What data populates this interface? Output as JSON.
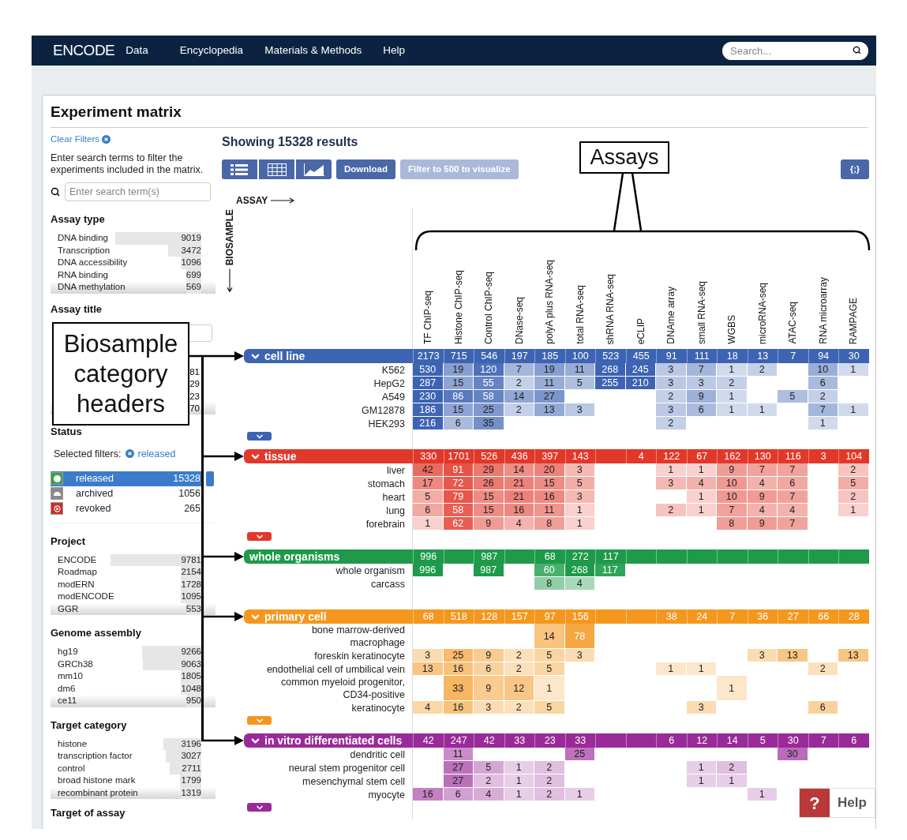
{
  "nav": {
    "logo": "ENCODE",
    "links": [
      "Data",
      "Encyclopedia",
      "Materials & Methods",
      "Help"
    ],
    "search": {
      "placeholder": "Search..."
    }
  },
  "title": "Experiment matrix",
  "sidebar": {
    "clear_filters": "Clear Filters",
    "intro": "Enter search terms to filter the experiments included in the matrix.",
    "search": {
      "placeholder": "Enter search term(s)"
    },
    "facets": [
      {
        "kind": "list",
        "title": "Assay type",
        "items": [
          {
            "label": "DNA binding",
            "count": "9019"
          },
          {
            "label": "Transcription",
            "count": "3472"
          },
          {
            "label": "DNA accessibility",
            "count": "1096"
          },
          {
            "label": "RNA binding",
            "count": "699"
          },
          {
            "label": "DNA methylation",
            "count": "569"
          }
        ]
      },
      {
        "kind": "covered",
        "title": "Assay title",
        "counts": [
          "81",
          "29",
          "23",
          "70"
        ]
      },
      {
        "kind": "status",
        "title": "Status",
        "selected_label": "Selected filters:",
        "selected_filters": [
          "released"
        ],
        "items": [
          {
            "kind": "released",
            "label": "released",
            "count": "15328",
            "selected": true
          },
          {
            "kind": "archived",
            "label": "archived",
            "count": "1056",
            "selected": false
          },
          {
            "kind": "revoked",
            "label": "revoked",
            "count": "265",
            "selected": false
          }
        ]
      },
      {
        "kind": "list",
        "title": "Project",
        "items": [
          {
            "label": "ENCODE",
            "count": "9781"
          },
          {
            "label": "Roadmap",
            "count": "2154"
          },
          {
            "label": "modERN",
            "count": "1728"
          },
          {
            "label": "modENCODE",
            "count": "1095"
          },
          {
            "label": "GGR",
            "count": "553"
          }
        ]
      },
      {
        "kind": "list",
        "title": "Genome assembly",
        "items": [
          {
            "label": "hg19",
            "count": "9266"
          },
          {
            "label": "GRCh38",
            "count": "9063"
          },
          {
            "label": "mm10",
            "count": "1805"
          },
          {
            "label": "dm6",
            "count": "1048"
          },
          {
            "label": "ce11",
            "count": "950"
          }
        ]
      },
      {
        "kind": "list",
        "title": "Target category",
        "items": [
          {
            "label": "histone",
            "count": "3196"
          },
          {
            "label": "transcription factor",
            "count": "3027"
          },
          {
            "label": "control",
            "count": "2711"
          },
          {
            "label": "broad histone mark",
            "count": "1799"
          },
          {
            "label": "recombinant protein",
            "count": "1319"
          }
        ]
      },
      {
        "kind": "heading",
        "title": "Target of assay"
      }
    ]
  },
  "results": {
    "heading": "Showing 15328 results",
    "views": [
      {
        "kind": "list"
      },
      {
        "kind": "table"
      },
      {
        "kind": "chart"
      }
    ],
    "buttons": [
      {
        "label": "Download",
        "disabled": false
      },
      {
        "label": "Filter to 500 to visualize",
        "disabled": true
      }
    ],
    "json_button": "{;}"
  },
  "matrix": {
    "assay_axis": "ASSAY",
    "biosample_axis": "BIOSAMPLE",
    "columns": [
      "TF ChIP-seq",
      "Histone ChIP-seq",
      "Control ChIP-seq",
      "DNase-seq",
      "polyA plus RNA-seq",
      "total RNA-seq",
      "shRNA RNA-seq",
      "eCLIP",
      "DNAme array",
      "small RNA-seq",
      "WGBS",
      "microRNA-seq",
      "ATAC-seq",
      "RNA microarray",
      "RAMPAGE"
    ],
    "categories": [
      {
        "name": "cell line",
        "color": "#3d63b3",
        "collapsible": true,
        "totals": [
          {
            "kind": "count",
            "value": "2173"
          },
          {
            "kind": "count",
            "value": "715"
          },
          {
            "kind": "count",
            "value": "546"
          },
          {
            "kind": "count",
            "value": "197"
          },
          {
            "kind": "count",
            "value": "185"
          },
          {
            "kind": "count",
            "value": "100"
          },
          {
            "kind": "count",
            "value": "523"
          },
          {
            "kind": "count",
            "value": "455"
          },
          {
            "kind": "count",
            "value": "91"
          },
          {
            "kind": "count",
            "value": "111"
          },
          {
            "kind": "count",
            "value": "18"
          },
          {
            "kind": "count",
            "value": "13"
          },
          {
            "kind": "count",
            "value": "7"
          },
          {
            "kind": "count",
            "value": "94"
          },
          {
            "kind": "count",
            "value": "30"
          }
        ],
        "rows": [
          {
            "label": "K562",
            "cells": [
              {
                "kind": "count",
                "value": "530"
              },
              {
                "kind": "count",
                "value": "19"
              },
              {
                "kind": "count",
                "value": "120"
              },
              {
                "kind": "count",
                "value": "7"
              },
              {
                "kind": "count",
                "value": "19"
              },
              {
                "kind": "count",
                "value": "11"
              },
              {
                "kind": "count",
                "value": "268"
              },
              {
                "kind": "count",
                "value": "245"
              },
              {
                "kind": "count",
                "value": "3"
              },
              {
                "kind": "count",
                "value": "7"
              },
              {
                "kind": "count",
                "value": "1"
              },
              {
                "kind": "count",
                "value": "2"
              },
              {
                "kind": "empty"
              },
              {
                "kind": "count",
                "value": "10"
              },
              {
                "kind": "count",
                "value": "1"
              }
            ]
          },
          {
            "label": "HepG2",
            "cells": [
              {
                "kind": "count",
                "value": "287"
              },
              {
                "kind": "count",
                "value": "15"
              },
              {
                "kind": "count",
                "value": "55"
              },
              {
                "kind": "count",
                "value": "2"
              },
              {
                "kind": "count",
                "value": "11"
              },
              {
                "kind": "count",
                "value": "5"
              },
              {
                "kind": "count",
                "value": "255"
              },
              {
                "kind": "count",
                "value": "210"
              },
              {
                "kind": "count",
                "value": "3"
              },
              {
                "kind": "count",
                "value": "3"
              },
              {
                "kind": "count",
                "value": "2"
              },
              {
                "kind": "empty"
              },
              {
                "kind": "empty"
              },
              {
                "kind": "count",
                "value": "6"
              },
              {
                "kind": "empty"
              }
            ]
          },
          {
            "label": "A549",
            "cells": [
              {
                "kind": "count",
                "value": "230"
              },
              {
                "kind": "count",
                "value": "86"
              },
              {
                "kind": "count",
                "value": "58"
              },
              {
                "kind": "count",
                "value": "14"
              },
              {
                "kind": "count",
                "value": "27"
              },
              {
                "kind": "empty"
              },
              {
                "kind": "empty"
              },
              {
                "kind": "empty"
              },
              {
                "kind": "count",
                "value": "2"
              },
              {
                "kind": "count",
                "value": "9"
              },
              {
                "kind": "count",
                "value": "1"
              },
              {
                "kind": "empty"
              },
              {
                "kind": "count",
                "value": "5"
              },
              {
                "kind": "count",
                "value": "2"
              },
              {
                "kind": "empty"
              }
            ]
          },
          {
            "label": "GM12878",
            "cells": [
              {
                "kind": "count",
                "value": "186"
              },
              {
                "kind": "count",
                "value": "15"
              },
              {
                "kind": "count",
                "value": "25"
              },
              {
                "kind": "count",
                "value": "2"
              },
              {
                "kind": "count",
                "value": "13"
              },
              {
                "kind": "count",
                "value": "3"
              },
              {
                "kind": "empty"
              },
              {
                "kind": "empty"
              },
              {
                "kind": "count",
                "value": "3"
              },
              {
                "kind": "count",
                "value": "6"
              },
              {
                "kind": "count",
                "value": "1"
              },
              {
                "kind": "count",
                "value": "1"
              },
              {
                "kind": "empty"
              },
              {
                "kind": "count",
                "value": "7"
              },
              {
                "kind": "count",
                "value": "1"
              }
            ]
          },
          {
            "label": "HEK293",
            "cells": [
              {
                "kind": "count",
                "value": "216"
              },
              {
                "kind": "count",
                "value": "6"
              },
              {
                "kind": "count",
                "value": "35"
              },
              {
                "kind": "empty"
              },
              {
                "kind": "empty"
              },
              {
                "kind": "empty"
              },
              {
                "kind": "empty"
              },
              {
                "kind": "empty"
              },
              {
                "kind": "count",
                "value": "2"
              },
              {
                "kind": "empty"
              },
              {
                "kind": "empty"
              },
              {
                "kind": "empty"
              },
              {
                "kind": "empty"
              },
              {
                "kind": "count",
                "value": "1"
              },
              {
                "kind": "empty"
              }
            ]
          }
        ]
      },
      {
        "name": "tissue",
        "color": "#e2382a",
        "collapsible": true,
        "totals": [
          {
            "kind": "count",
            "value": "330"
          },
          {
            "kind": "count",
            "value": "1701"
          },
          {
            "kind": "count",
            "value": "526"
          },
          {
            "kind": "count",
            "value": "436"
          },
          {
            "kind": "count",
            "value": "397"
          },
          {
            "kind": "count",
            "value": "143"
          },
          {
            "kind": "empty"
          },
          {
            "kind": "count",
            "value": "4"
          },
          {
            "kind": "count",
            "value": "122"
          },
          {
            "kind": "count",
            "value": "67"
          },
          {
            "kind": "count",
            "value": "162"
          },
          {
            "kind": "count",
            "value": "130"
          },
          {
            "kind": "count",
            "value": "116"
          },
          {
            "kind": "count",
            "value": "3"
          },
          {
            "kind": "count",
            "value": "104"
          }
        ],
        "rows": [
          {
            "label": "liver",
            "cells": [
              {
                "kind": "count",
                "value": "42"
              },
              {
                "kind": "count",
                "value": "91"
              },
              {
                "kind": "count",
                "value": "29"
              },
              {
                "kind": "count",
                "value": "14"
              },
              {
                "kind": "count",
                "value": "20"
              },
              {
                "kind": "count",
                "value": "3"
              },
              {
                "kind": "empty"
              },
              {
                "kind": "empty"
              },
              {
                "kind": "count",
                "value": "1"
              },
              {
                "kind": "count",
                "value": "1"
              },
              {
                "kind": "count",
                "value": "9"
              },
              {
                "kind": "count",
                "value": "7"
              },
              {
                "kind": "count",
                "value": "7"
              },
              {
                "kind": "empty"
              },
              {
                "kind": "count",
                "value": "2"
              }
            ]
          },
          {
            "label": "stomach",
            "cells": [
              {
                "kind": "count",
                "value": "17"
              },
              {
                "kind": "count",
                "value": "72"
              },
              {
                "kind": "count",
                "value": "26"
              },
              {
                "kind": "count",
                "value": "21"
              },
              {
                "kind": "count",
                "value": "15"
              },
              {
                "kind": "count",
                "value": "5"
              },
              {
                "kind": "empty"
              },
              {
                "kind": "empty"
              },
              {
                "kind": "count",
                "value": "3"
              },
              {
                "kind": "count",
                "value": "4"
              },
              {
                "kind": "count",
                "value": "10"
              },
              {
                "kind": "count",
                "value": "4"
              },
              {
                "kind": "count",
                "value": "6"
              },
              {
                "kind": "empty"
              },
              {
                "kind": "count",
                "value": "5"
              }
            ]
          },
          {
            "label": "heart",
            "cells": [
              {
                "kind": "count",
                "value": "5"
              },
              {
                "kind": "count",
                "value": "79"
              },
              {
                "kind": "count",
                "value": "15"
              },
              {
                "kind": "count",
                "value": "21"
              },
              {
                "kind": "count",
                "value": "16"
              },
              {
                "kind": "count",
                "value": "3"
              },
              {
                "kind": "empty"
              },
              {
                "kind": "empty"
              },
              {
                "kind": "empty"
              },
              {
                "kind": "count",
                "value": "1"
              },
              {
                "kind": "count",
                "value": "10"
              },
              {
                "kind": "count",
                "value": "9"
              },
              {
                "kind": "count",
                "value": "7"
              },
              {
                "kind": "empty"
              },
              {
                "kind": "count",
                "value": "2"
              }
            ]
          },
          {
            "label": "lung",
            "cells": [
              {
                "kind": "count",
                "value": "6"
              },
              {
                "kind": "count",
                "value": "58"
              },
              {
                "kind": "count",
                "value": "15"
              },
              {
                "kind": "count",
                "value": "16"
              },
              {
                "kind": "count",
                "value": "11"
              },
              {
                "kind": "count",
                "value": "1"
              },
              {
                "kind": "empty"
              },
              {
                "kind": "empty"
              },
              {
                "kind": "count",
                "value": "2"
              },
              {
                "kind": "count",
                "value": "1"
              },
              {
                "kind": "count",
                "value": "7"
              },
              {
                "kind": "count",
                "value": "4"
              },
              {
                "kind": "count",
                "value": "4"
              },
              {
                "kind": "empty"
              },
              {
                "kind": "count",
                "value": "1"
              }
            ]
          },
          {
            "label": "forebrain",
            "cells": [
              {
                "kind": "count",
                "value": "1"
              },
              {
                "kind": "count",
                "value": "62"
              },
              {
                "kind": "count",
                "value": "9"
              },
              {
                "kind": "count",
                "value": "4"
              },
              {
                "kind": "count",
                "value": "8"
              },
              {
                "kind": "count",
                "value": "1"
              },
              {
                "kind": "empty"
              },
              {
                "kind": "empty"
              },
              {
                "kind": "empty"
              },
              {
                "kind": "empty"
              },
              {
                "kind": "count",
                "value": "8"
              },
              {
                "kind": "count",
                "value": "9"
              },
              {
                "kind": "count",
                "value": "7"
              },
              {
                "kind": "empty"
              },
              {
                "kind": "empty"
              }
            ]
          }
        ]
      },
      {
        "name": "whole organisms",
        "color": "#1e9a4a",
        "collapsible": false,
        "totals": [
          {
            "kind": "count",
            "value": "996"
          },
          {
            "kind": "empty"
          },
          {
            "kind": "count",
            "value": "987"
          },
          {
            "kind": "empty"
          },
          {
            "kind": "count",
            "value": "68"
          },
          {
            "kind": "count",
            "value": "272"
          },
          {
            "kind": "count",
            "value": "117"
          },
          {
            "kind": "empty"
          },
          {
            "kind": "empty"
          },
          {
            "kind": "empty"
          },
          {
            "kind": "empty"
          },
          {
            "kind": "empty"
          },
          {
            "kind": "empty"
          },
          {
            "kind": "empty"
          },
          {
            "kind": "empty"
          }
        ],
        "rows": [
          {
            "label": "whole organism",
            "cells": [
              {
                "kind": "count",
                "value": "996"
              },
              {
                "kind": "empty"
              },
              {
                "kind": "count",
                "value": "987"
              },
              {
                "kind": "empty"
              },
              {
                "kind": "count",
                "value": "60"
              },
              {
                "kind": "count",
                "value": "268"
              },
              {
                "kind": "count",
                "value": "117"
              },
              {
                "kind": "empty"
              },
              {
                "kind": "empty"
              },
              {
                "kind": "empty"
              },
              {
                "kind": "empty"
              },
              {
                "kind": "empty"
              },
              {
                "kind": "empty"
              },
              {
                "kind": "empty"
              },
              {
                "kind": "empty"
              }
            ]
          },
          {
            "label": "carcass",
            "cells": [
              {
                "kind": "empty"
              },
              {
                "kind": "empty"
              },
              {
                "kind": "empty"
              },
              {
                "kind": "empty"
              },
              {
                "kind": "count",
                "value": "8"
              },
              {
                "kind": "count",
                "value": "4"
              },
              {
                "kind": "empty"
              },
              {
                "kind": "empty"
              },
              {
                "kind": "empty"
              },
              {
                "kind": "empty"
              },
              {
                "kind": "empty"
              },
              {
                "kind": "empty"
              },
              {
                "kind": "empty"
              },
              {
                "kind": "empty"
              },
              {
                "kind": "empty"
              }
            ]
          }
        ]
      },
      {
        "name": "primary cell",
        "color": "#f4971f",
        "collapsible": true,
        "totals": [
          {
            "kind": "count",
            "value": "68"
          },
          {
            "kind": "count",
            "value": "518"
          },
          {
            "kind": "count",
            "value": "128"
          },
          {
            "kind": "count",
            "value": "157"
          },
          {
            "kind": "count",
            "value": "97"
          },
          {
            "kind": "count",
            "value": "156"
          },
          {
            "kind": "empty"
          },
          {
            "kind": "empty"
          },
          {
            "kind": "count",
            "value": "38"
          },
          {
            "kind": "count",
            "value": "24"
          },
          {
            "kind": "count",
            "value": "7"
          },
          {
            "kind": "count",
            "value": "36"
          },
          {
            "kind": "count",
            "value": "27"
          },
          {
            "kind": "count",
            "value": "66"
          },
          {
            "kind": "count",
            "value": "28"
          }
        ],
        "rows": [
          {
            "label": "bone marrow-derived macrophage",
            "cells": [
              {
                "kind": "empty"
              },
              {
                "kind": "empty"
              },
              {
                "kind": "empty"
              },
              {
                "kind": "empty"
              },
              {
                "kind": "count",
                "value": "14"
              },
              {
                "kind": "count",
                "value": "78"
              },
              {
                "kind": "empty"
              },
              {
                "kind": "empty"
              },
              {
                "kind": "empty"
              },
              {
                "kind": "empty"
              },
              {
                "kind": "empty"
              },
              {
                "kind": "empty"
              },
              {
                "kind": "empty"
              },
              {
                "kind": "empty"
              },
              {
                "kind": "empty"
              }
            ]
          },
          {
            "label": "foreskin keratinocyte",
            "cells": [
              {
                "kind": "count",
                "value": "3"
              },
              {
                "kind": "count",
                "value": "25"
              },
              {
                "kind": "count",
                "value": "9"
              },
              {
                "kind": "count",
                "value": "2"
              },
              {
                "kind": "count",
                "value": "5"
              },
              {
                "kind": "count",
                "value": "3"
              },
              {
                "kind": "empty"
              },
              {
                "kind": "empty"
              },
              {
                "kind": "empty"
              },
              {
                "kind": "empty"
              },
              {
                "kind": "empty"
              },
              {
                "kind": "count",
                "value": "3"
              },
              {
                "kind": "count",
                "value": "13"
              },
              {
                "kind": "empty"
              },
              {
                "kind": "count",
                "value": "13"
              }
            ]
          },
          {
            "label": "endothelial cell of umbilical vein",
            "cells": [
              {
                "kind": "count",
                "value": "13"
              },
              {
                "kind": "count",
                "value": "16"
              },
              {
                "kind": "count",
                "value": "6"
              },
              {
                "kind": "count",
                "value": "2"
              },
              {
                "kind": "count",
                "value": "5"
              },
              {
                "kind": "empty"
              },
              {
                "kind": "empty"
              },
              {
                "kind": "empty"
              },
              {
                "kind": "count",
                "value": "1"
              },
              {
                "kind": "count",
                "value": "1"
              },
              {
                "kind": "empty"
              },
              {
                "kind": "empty"
              },
              {
                "kind": "empty"
              },
              {
                "kind": "count",
                "value": "2"
              },
              {
                "kind": "empty"
              }
            ]
          },
          {
            "label": "common myeloid progenitor, CD34-positive",
            "cells": [
              {
                "kind": "empty"
              },
              {
                "kind": "count",
                "value": "33"
              },
              {
                "kind": "count",
                "value": "9"
              },
              {
                "kind": "count",
                "value": "12"
              },
              {
                "kind": "count",
                "value": "1"
              },
              {
                "kind": "empty"
              },
              {
                "kind": "empty"
              },
              {
                "kind": "empty"
              },
              {
                "kind": "empty"
              },
              {
                "kind": "empty"
              },
              {
                "kind": "count",
                "value": "1"
              },
              {
                "kind": "empty"
              },
              {
                "kind": "empty"
              },
              {
                "kind": "empty"
              },
              {
                "kind": "empty"
              }
            ]
          },
          {
            "label": "keratinocyte",
            "cells": [
              {
                "kind": "count",
                "value": "4"
              },
              {
                "kind": "count",
                "value": "16"
              },
              {
                "kind": "count",
                "value": "3"
              },
              {
                "kind": "count",
                "value": "2"
              },
              {
                "kind": "count",
                "value": "5"
              },
              {
                "kind": "empty"
              },
              {
                "kind": "empty"
              },
              {
                "kind": "empty"
              },
              {
                "kind": "empty"
              },
              {
                "kind": "count",
                "value": "3"
              },
              {
                "kind": "empty"
              },
              {
                "kind": "empty"
              },
              {
                "kind": "empty"
              },
              {
                "kind": "count",
                "value": "6"
              },
              {
                "kind": "empty"
              }
            ]
          }
        ]
      },
      {
        "name": "in vitro differentiated cells",
        "color": "#9a2a99",
        "collapsible": true,
        "totals": [
          {
            "kind": "count",
            "value": "42"
          },
          {
            "kind": "count",
            "value": "247"
          },
          {
            "kind": "count",
            "value": "42"
          },
          {
            "kind": "count",
            "value": "33"
          },
          {
            "kind": "count",
            "value": "23"
          },
          {
            "kind": "count",
            "value": "33"
          },
          {
            "kind": "empty"
          },
          {
            "kind": "empty"
          },
          {
            "kind": "count",
            "value": "6"
          },
          {
            "kind": "count",
            "value": "12"
          },
          {
            "kind": "count",
            "value": "14"
          },
          {
            "kind": "count",
            "value": "5"
          },
          {
            "kind": "count",
            "value": "30"
          },
          {
            "kind": "count",
            "value": "7"
          },
          {
            "kind": "count",
            "value": "6"
          }
        ],
        "rows": [
          {
            "label": "dendritic cell",
            "cells": [
              {
                "kind": "empty"
              },
              {
                "kind": "count",
                "value": "11"
              },
              {
                "kind": "empty"
              },
              {
                "kind": "empty"
              },
              {
                "kind": "empty"
              },
              {
                "kind": "count",
                "value": "25"
              },
              {
                "kind": "empty"
              },
              {
                "kind": "empty"
              },
              {
                "kind": "empty"
              },
              {
                "kind": "empty"
              },
              {
                "kind": "empty"
              },
              {
                "kind": "empty"
              },
              {
                "kind": "count",
                "value": "30"
              },
              {
                "kind": "empty"
              },
              {
                "kind": "empty"
              }
            ]
          },
          {
            "label": "neural stem progenitor cell",
            "cells": [
              {
                "kind": "empty"
              },
              {
                "kind": "count",
                "value": "27"
              },
              {
                "kind": "count",
                "value": "5"
              },
              {
                "kind": "count",
                "value": "1"
              },
              {
                "kind": "count",
                "value": "2"
              },
              {
                "kind": "empty"
              },
              {
                "kind": "empty"
              },
              {
                "kind": "empty"
              },
              {
                "kind": "empty"
              },
              {
                "kind": "count",
                "value": "1"
              },
              {
                "kind": "count",
                "value": "2"
              },
              {
                "kind": "empty"
              },
              {
                "kind": "empty"
              },
              {
                "kind": "empty"
              },
              {
                "kind": "empty"
              }
            ]
          },
          {
            "label": "mesenchymal stem cell",
            "cells": [
              {
                "kind": "empty"
              },
              {
                "kind": "count",
                "value": "27"
              },
              {
                "kind": "count",
                "value": "2"
              },
              {
                "kind": "count",
                "value": "1"
              },
              {
                "kind": "count",
                "value": "2"
              },
              {
                "kind": "empty"
              },
              {
                "kind": "empty"
              },
              {
                "kind": "empty"
              },
              {
                "kind": "empty"
              },
              {
                "kind": "count",
                "value": "1"
              },
              {
                "kind": "count",
                "value": "1"
              },
              {
                "kind": "empty"
              },
              {
                "kind": "empty"
              },
              {
                "kind": "empty"
              },
              {
                "kind": "empty"
              }
            ]
          },
          {
            "label": "myocyte",
            "cells": [
              {
                "kind": "count",
                "value": "16"
              },
              {
                "kind": "count",
                "value": "6"
              },
              {
                "kind": "count",
                "value": "4"
              },
              {
                "kind": "count",
                "value": "1"
              },
              {
                "kind": "count",
                "value": "2"
              },
              {
                "kind": "count",
                "value": "1"
              },
              {
                "kind": "empty"
              },
              {
                "kind": "empty"
              },
              {
                "kind": "empty"
              },
              {
                "kind": "empty"
              },
              {
                "kind": "empty"
              },
              {
                "kind": "count",
                "value": "1"
              },
              {
                "kind": "empty"
              },
              {
                "kind": "empty"
              },
              {
                "kind": "empty"
              }
            ]
          }
        ]
      }
    ]
  },
  "annotations": [
    {
      "kind": "assays",
      "text": "Assays"
    },
    {
      "kind": "biosample",
      "text": "Biosample category headers"
    }
  ],
  "help": {
    "icon": "?",
    "label": "Help"
  }
}
